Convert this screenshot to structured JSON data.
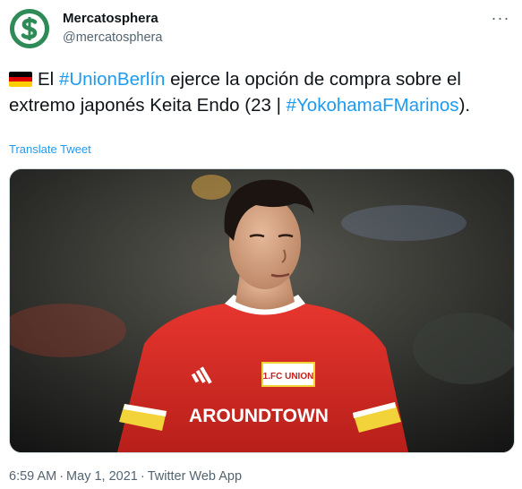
{
  "author": {
    "display_name": "Mercatosphera",
    "handle": "@mercatosphera",
    "avatar_icon": "dollar-s-logo-icon",
    "avatar_color": "#2e8b57"
  },
  "tweet": {
    "flag_icon": "germany-flag-icon",
    "text_before": "El ",
    "hashtag1": "#UnionBerlín",
    "text_middle": " ejerce la opción de compra sobre el extremo japonés Keita Endo (23 | ",
    "hashtag2": "#YokohamaFMarinos",
    "text_after": ").",
    "translate_label": "Translate Tweet",
    "link_color": "#1d9bf0"
  },
  "media": {
    "jersey_sponsor": "AROUNDTOWN",
    "club_badge_text": "1.FC UNION"
  },
  "meta": {
    "time": "6:59 AM",
    "separator": "·",
    "date": "May 1, 2021",
    "source": "Twitter Web App"
  },
  "more_icon": "more-dots-icon"
}
